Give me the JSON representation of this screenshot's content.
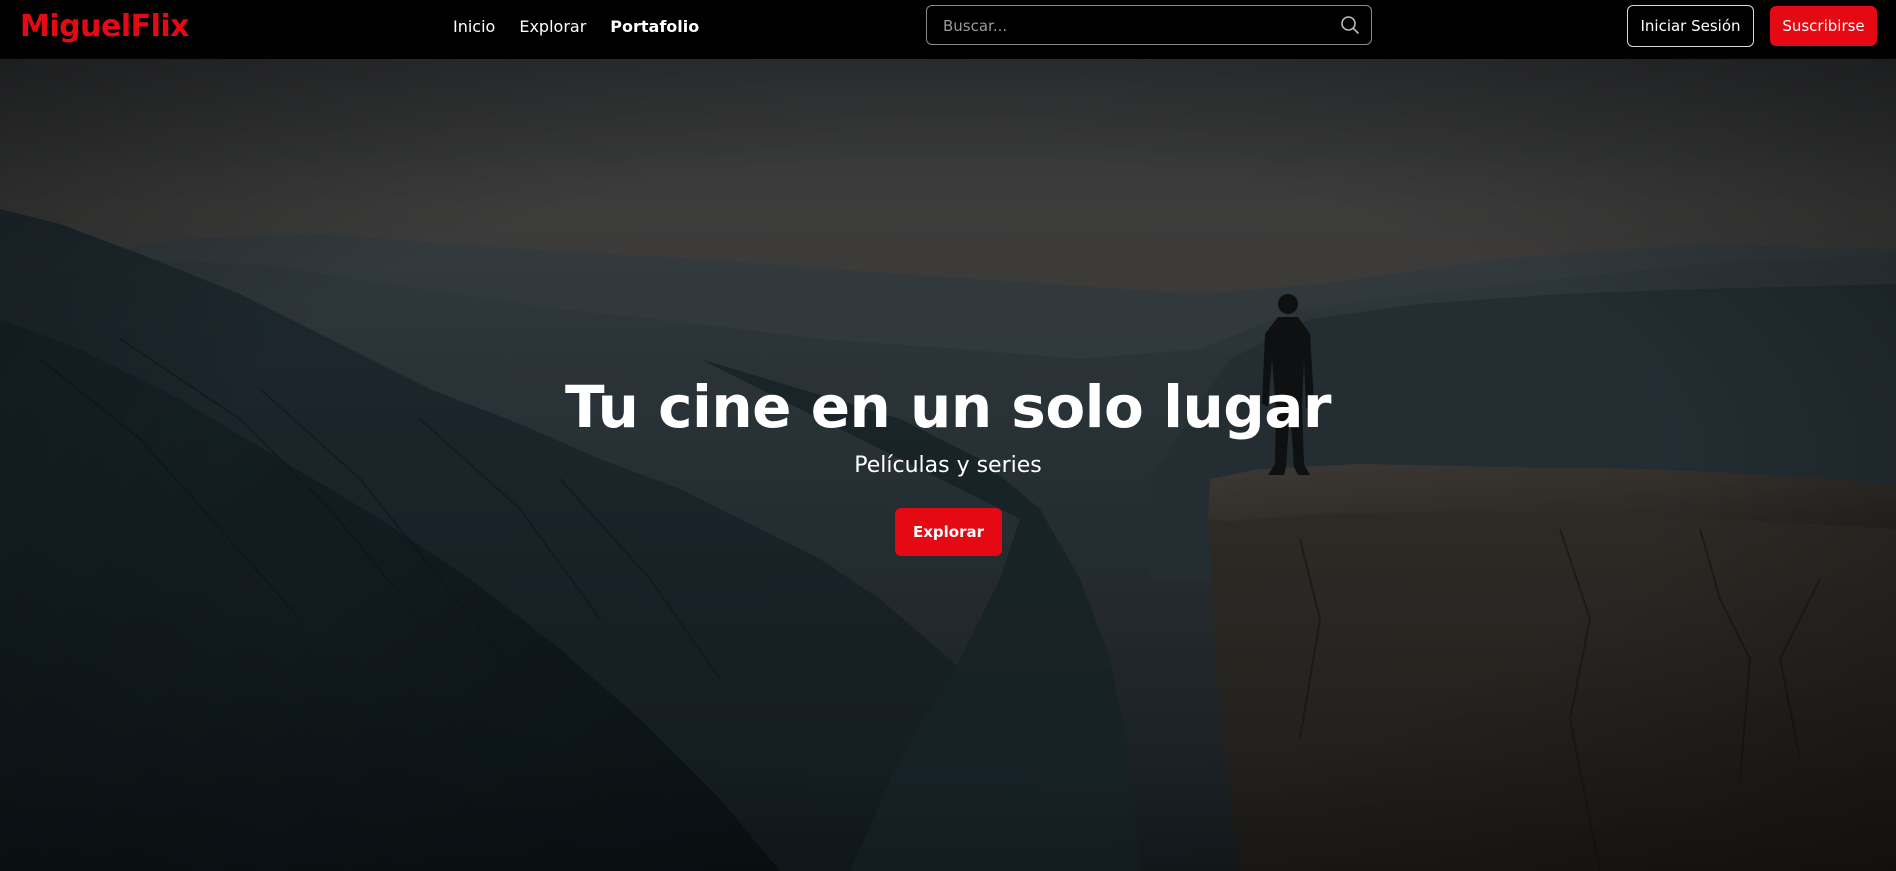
{
  "header": {
    "logo": "MiguelFlix",
    "nav": [
      {
        "label": "Inicio",
        "active": false
      },
      {
        "label": "Explorar",
        "active": false
      },
      {
        "label": "Portafolio",
        "active": true
      }
    ],
    "search": {
      "placeholder": "Buscar...",
      "value": "",
      "icon": "search-icon"
    },
    "login_label": "Iniciar Sesión",
    "subscribe_label": "Suscribirse"
  },
  "hero": {
    "title": "Tu cine en un solo lugar",
    "subtitle": "Películas y series",
    "cta_label": "Explorar",
    "image": "person-on-cliff-photo"
  },
  "colors": {
    "brand": "#e50914",
    "header_bg": "#000000",
    "text": "#ffffff"
  }
}
